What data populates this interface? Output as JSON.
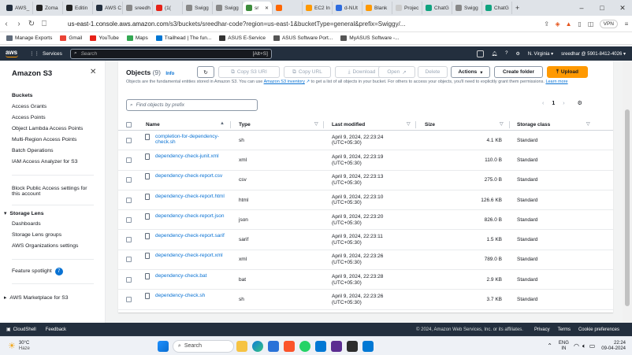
{
  "browser": {
    "tabs": [
      {
        "label": "AWS_",
        "color": "#232f3e"
      },
      {
        "label": "Zoma",
        "color": "#222"
      },
      {
        "label": "Editin",
        "color": "#222"
      },
      {
        "label": "AWS C",
        "color": "#232f3e"
      },
      {
        "label": "sreedh",
        "color": "#888"
      },
      {
        "label": "(1(",
        "color": "#e62117"
      },
      {
        "label": "Swigg",
        "color": "#888"
      },
      {
        "label": "Swigg",
        "color": "#888"
      },
      {
        "label": "sr",
        "color": "#3c8c3c",
        "active": true
      },
      {
        "label": "",
        "color": "#ff6600"
      },
      {
        "label": "EC2 In",
        "color": "#ff9900"
      },
      {
        "label": "d-NUt",
        "color": "#2d6cdf"
      },
      {
        "label": "Blank",
        "color": "#ff9900"
      },
      {
        "label": "Projec",
        "color": "#ccc"
      },
      {
        "label": "ChatG",
        "color": "#10a37f"
      },
      {
        "label": "Swigg",
        "color": "#888"
      },
      {
        "label": "ChatG",
        "color": "#10a37f"
      }
    ],
    "new_tab": "+",
    "url_host": "us-east-1.console.aws.amazon.com",
    "url_rest": "/s3/buckets/sreedhar-code?region=us-east-1&bucketType=general&prefix=Swiggy/...",
    "vpn": "VPN",
    "bookmarks": [
      {
        "label": "Manage Exports",
        "color": "#5f6b7a"
      },
      {
        "label": "Gmail",
        "color": "#ea4335"
      },
      {
        "label": "YouTube",
        "color": "#e62117"
      },
      {
        "label": "Maps",
        "color": "#34a853"
      },
      {
        "label": "Trailhead | The fun...",
        "color": "#0176d3"
      },
      {
        "label": "ASUS E-Service",
        "color": "#333"
      },
      {
        "label": "ASUS Software Port...",
        "color": "#555"
      },
      {
        "label": "MyASUS Software -...",
        "color": "#555"
      }
    ]
  },
  "aws_nav": {
    "logo": "aws",
    "services": "Services",
    "search_placeholder": "Search",
    "search_shortcut": "[Alt+S]",
    "region": "N. Virginia",
    "account": "sreedhar @ 5901-8412-4026"
  },
  "sidebar": {
    "title": "Amazon S3",
    "items": [
      "Buckets",
      "Access Grants",
      "Access Points",
      "Object Lambda Access Points",
      "Multi-Region Access Points",
      "Batch Operations",
      "IAM Access Analyzer for S3"
    ],
    "block_public_1": "Block Public Access settings for",
    "block_public_2": "this account",
    "storage_lens": "Storage Lens",
    "lens_items": [
      "Dashboards",
      "Storage Lens groups",
      "AWS Organizations settings"
    ],
    "feature_spotlight": "Feature spotlight",
    "spotlight_count": "7",
    "marketplace": "AWS Marketplace for S3"
  },
  "objects": {
    "title": "Objects",
    "count": "(9)",
    "info": "Info",
    "desc_pre": "Objects are the fundamental entities stored in Amazon S3. You can use ",
    "desc_link": "Amazon S3 inventory",
    "desc_post": " to get a list of all objects in your bucket. For others to access your objects, you'll need to explicitly grant them permissions. ",
    "desc_more": "Learn more",
    "buttons": {
      "copy_uri": "Copy S3 URI",
      "copy_url": "Copy URL",
      "download": "Download",
      "open": "Open",
      "delete": "Delete",
      "actions": "Actions",
      "create_folder": "Create folder",
      "upload": "Upload"
    },
    "find_placeholder": "Find objects by prefix",
    "page": "1",
    "columns": [
      "Name",
      "Type",
      "Last modified",
      "Size",
      "Storage class"
    ],
    "rows": [
      {
        "name": "completion-for-dependency-check.sh",
        "type": "sh",
        "modified": "April 9, 2024, 22:23:24",
        "tz": "(UTC+05:30)",
        "size": "4.1 KB",
        "class": "Standard"
      },
      {
        "name": "dependency-check-junit.xml",
        "type": "xml",
        "modified": "April 9, 2024, 22:23:19",
        "tz": "(UTC+05:30)",
        "size": "110.0 B",
        "class": "Standard"
      },
      {
        "name": "dependency-check-report.csv",
        "type": "csv",
        "modified": "April 9, 2024, 22:23:13",
        "tz": "(UTC+05:30)",
        "size": "275.0 B",
        "class": "Standard"
      },
      {
        "name": "dependency-check-report.html",
        "type": "html",
        "modified": "April 9, 2024, 22:23:10",
        "tz": "(UTC+05:30)",
        "size": "126.6 KB",
        "class": "Standard"
      },
      {
        "name": "dependency-check-report.json",
        "type": "json",
        "modified": "April 9, 2024, 22:23:20",
        "tz": "(UTC+05:30)",
        "size": "826.0 B",
        "class": "Standard"
      },
      {
        "name": "dependency-check-report.sarif",
        "type": "sarif",
        "modified": "April 9, 2024, 22:23:11",
        "tz": "(UTC+05:30)",
        "size": "1.5 KB",
        "class": "Standard"
      },
      {
        "name": "dependency-check-report.xml",
        "type": "xml",
        "modified": "April 9, 2024, 22:23:26",
        "tz": "(UTC+05:30)",
        "size": "789.0 B",
        "class": "Standard"
      },
      {
        "name": "dependency-check.bat",
        "type": "bat",
        "modified": "April 9, 2024, 22:23:28",
        "tz": "(UTC+05:30)",
        "size": "2.9 KB",
        "class": "Standard"
      },
      {
        "name": "dependency-check.sh",
        "type": "sh",
        "modified": "April 9, 2024, 22:23:26",
        "tz": "(UTC+05:30)",
        "size": "3.7 KB",
        "class": "Standard"
      }
    ]
  },
  "footer": {
    "cloudshell": "CloudShell",
    "feedback": "Feedback",
    "copyright": "© 2024, Amazon Web Services, Inc. or its affiliates.",
    "privacy": "Privacy",
    "terms": "Terms",
    "cookie": "Cookie preferences"
  },
  "taskbar": {
    "temp": "30°C",
    "weather": "Haze",
    "search": "Search",
    "lang1": "ENG",
    "lang2": "IN",
    "time": "22:24",
    "date": "09-04-2024"
  }
}
